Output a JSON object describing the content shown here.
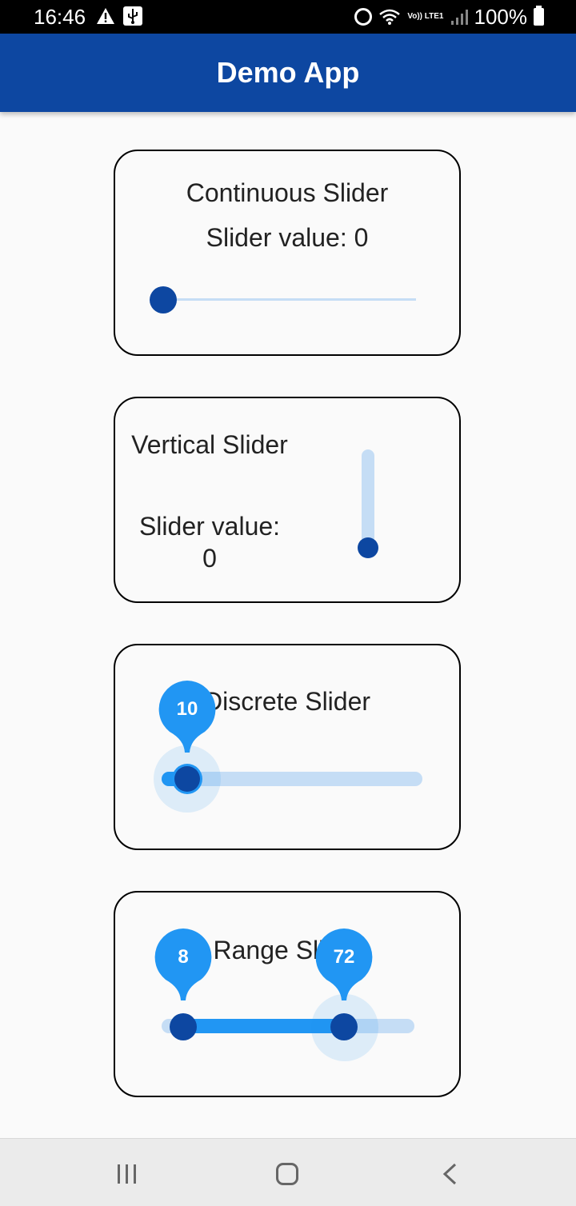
{
  "status_bar": {
    "time": "16:46",
    "battery": "100%",
    "network_label": "Vo)) LTE1",
    "icons": [
      "warning-icon",
      "usb-icon",
      "alarm-icon",
      "wifi-icon",
      "volte-icon",
      "signal-icon",
      "battery-icon"
    ]
  },
  "app_bar": {
    "title": "Demo App",
    "color": "#0d47a1"
  },
  "colors": {
    "thumb": "#0d47a1",
    "active_track": "#2196f3",
    "inactive_track": "#c5ddf5"
  },
  "continuous_slider": {
    "title": "Continuous Slider",
    "value_text": "Slider value: 0",
    "value": 0
  },
  "vertical_slider": {
    "title": "Vertical Slider",
    "value_label": "Slider value:",
    "value": "0"
  },
  "discrete_slider": {
    "title": "Discrete Slider",
    "indicator_value": "10",
    "value": 10
  },
  "range_slider": {
    "title": "Range Slider",
    "start_value": "8",
    "end_value": "72",
    "start": 8,
    "end": 72
  },
  "nav_bar": {
    "icons": [
      "recents-icon",
      "home-icon",
      "back-icon"
    ]
  }
}
